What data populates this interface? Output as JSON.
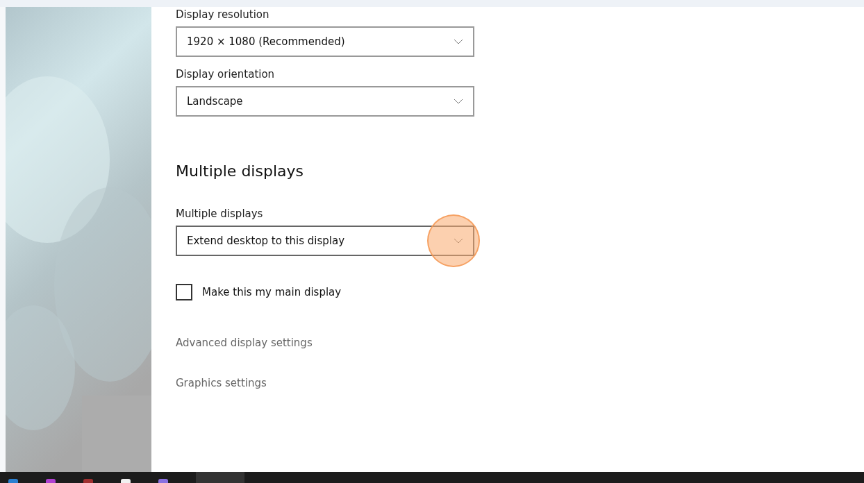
{
  "settings": [
    {
      "kind": "dropdown",
      "label": "Display resolution",
      "value": "1920 × 1080 (Recommended)",
      "highlighted": false
    },
    {
      "kind": "dropdown",
      "label": "Display orientation",
      "value": "Landscape",
      "highlighted": false
    },
    {
      "kind": "heading",
      "text": "Multiple displays"
    },
    {
      "kind": "dropdown",
      "label": "Multiple displays",
      "value": "Extend desktop to this display",
      "highlighted": true
    },
    {
      "kind": "checkbox",
      "label": "Make this my main display",
      "checked": false
    },
    {
      "kind": "link",
      "text": "Advanced display settings"
    },
    {
      "kind": "link",
      "text": "Graphics settings"
    }
  ]
}
